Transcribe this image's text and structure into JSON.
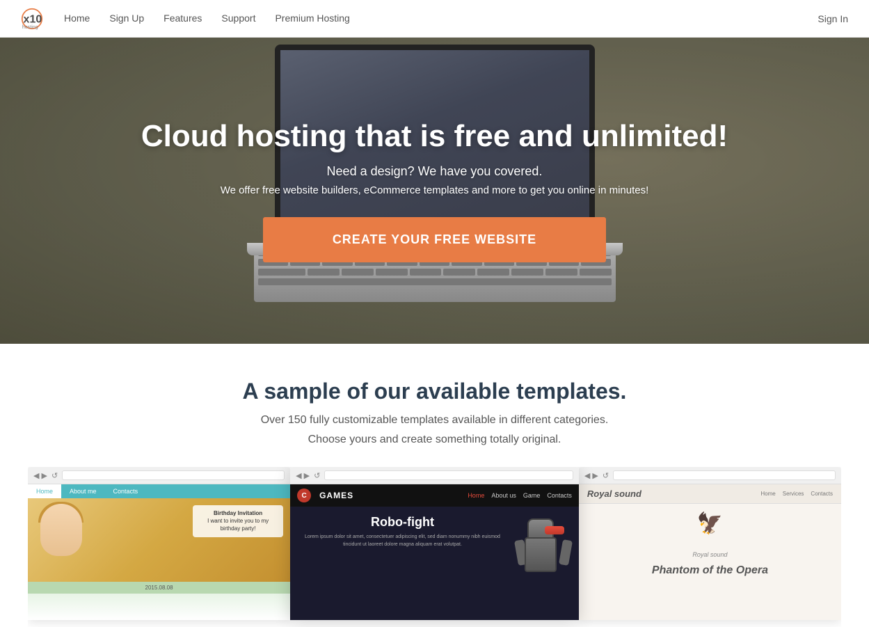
{
  "brand": {
    "name": "x10hosting",
    "logo_symbol": "✕"
  },
  "navbar": {
    "links": [
      {
        "label": "Home",
        "id": "nav-home"
      },
      {
        "label": "Sign Up",
        "id": "nav-signup"
      },
      {
        "label": "Features",
        "id": "nav-features"
      },
      {
        "label": "Support",
        "id": "nav-support"
      },
      {
        "label": "Premium Hosting",
        "id": "nav-premium"
      }
    ],
    "sign_in": "Sign In"
  },
  "hero": {
    "title": "Cloud hosting that is free and unlimited!",
    "subtitle": "Need a design? We have you covered.",
    "description": "We offer free website builders, eCommerce templates and more to get you online in minutes!",
    "cta_label": "CREATE YOUR FREE WEBSITE"
  },
  "templates": {
    "title": "A sample of our available templates.",
    "subtitle": "Over 150 fully customizable templates available in different categories.",
    "sub2": "Choose yours and create something totally original.",
    "previews": [
      {
        "id": "birthday",
        "title": "Birthday Invitation",
        "nav_items": [
          "Home",
          "About me",
          "Contacts"
        ],
        "text": "I want to invite you to my birthday party!"
      },
      {
        "id": "games",
        "brand": "GAMES",
        "title": "Robo-fight",
        "description": "Lorem ipsum dolor sit amet, consectetuer adipiscing elit, sed diam nonummy nibh euismod tincidunt ut laoreet dolore magna aliquam erat volutpat.",
        "nav_items": [
          "Home",
          "About us",
          "Game",
          "Contacts"
        ]
      },
      {
        "id": "royal",
        "brand": "Royal sound",
        "title": "Phantom of the Opera",
        "nav_items": [
          "Home",
          "Services",
          "Contacts"
        ]
      }
    ]
  }
}
